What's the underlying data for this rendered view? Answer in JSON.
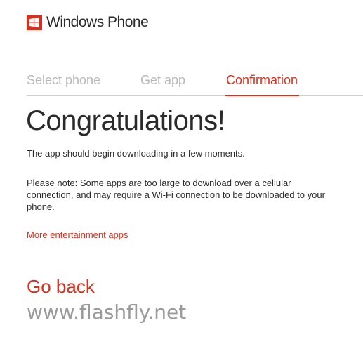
{
  "logo": {
    "brand_text": "Windows Phone",
    "brand_color": "#d9301e"
  },
  "steps": [
    {
      "label": "Select phone",
      "state": "inactive"
    },
    {
      "label": "Get app",
      "state": "inactive"
    },
    {
      "label": "Confirmation",
      "state": "active"
    }
  ],
  "main": {
    "title": "Congratulations!",
    "download_message": "The app should begin downloading in a few moments.",
    "note": "Please note: Some apps are too large to download over a cellular connection, and may require a Wi-Fi connection to be downloaded to your phone.",
    "more_link": "More entertainment apps",
    "go_back": "Go back"
  },
  "watermark": "www.flashfly.net",
  "colors": {
    "accent": "#d9301e",
    "text": "#2a2a2a",
    "inactive_step": "#b8b8b8",
    "watermark": "#9a9a9a"
  }
}
